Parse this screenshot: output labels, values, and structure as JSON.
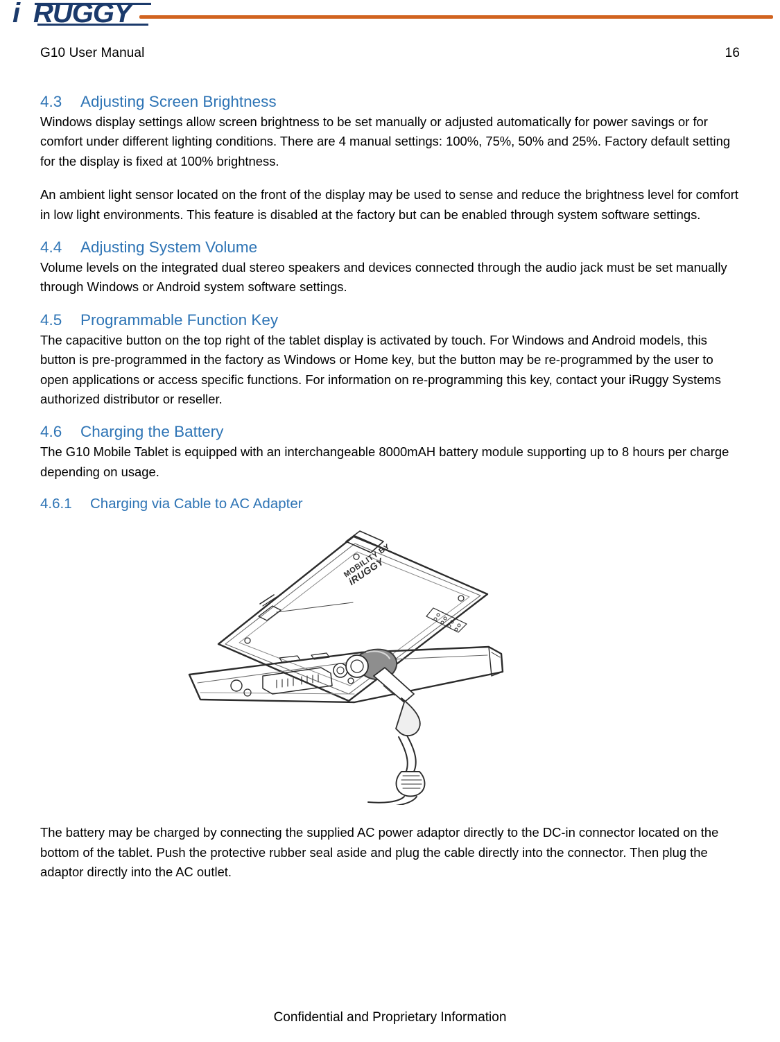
{
  "header": {
    "logo_text": "iRUGGY",
    "doc_title": "G10 User Manual",
    "page_number": "16",
    "rule_color": "#d1631f"
  },
  "sections": [
    {
      "number": "4.3",
      "title": "Adjusting Screen Brightness",
      "paragraphs": [
        "Windows display settings allow screen brightness to be set manually or adjusted automatically for power savings or for comfort under different lighting conditions.  There are 4 manual settings: 100%, 75%, 50% and 25%.  Factory default setting for the display is fixed at 100% brightness.",
        "An ambient light sensor located on the front of the display may be used to sense and reduce the brightness level for comfort in low light environments.  This feature is disabled at the factory but can be enabled through system software settings."
      ]
    },
    {
      "number": "4.4",
      "title": "Adjusting System Volume",
      "paragraphs": [
        "Volume levels on the integrated dual stereo speakers and devices connected through the audio jack must be set manually through Windows or Android system software settings."
      ]
    },
    {
      "number": "4.5",
      "title": "Programmable Function Key",
      "paragraphs": [
        "The capacitive button on the top right of the tablet display is activated by touch. For Windows and Android models, this button is pre-programmed in the factory as Windows or Home key, but the button may be re-programmed by the user to open applications or access specific functions.  For information on re-programming this key, contact your iRuggy Systems authorized distributor or reseller."
      ]
    },
    {
      "number": "4.6",
      "title": "Charging the Battery",
      "paragraphs": [
        "The G10 Mobile Tablet is equipped with an interchangeable 8000mAH battery module supporting up to 8 hours per charge depending on usage."
      ]
    }
  ],
  "subsection": {
    "number": "4.6.1",
    "title": "Charging via Cable to AC Adapter"
  },
  "figure": {
    "caption_text": "MOBILITY BY iRUGGY",
    "alt": "Line drawing of tablet bottom edge with DC-in power cable plugged into connector"
  },
  "closing_paragraph": "The battery may be charged by connecting the supplied AC power adaptor directly to the DC-in connector located on the bottom of the tablet.  Push the protective rubber seal aside and plug the cable directly into the connector.  Then plug the adaptor directly into the AC outlet.",
  "footer": {
    "text": "Confidential and Proprietary Information"
  }
}
